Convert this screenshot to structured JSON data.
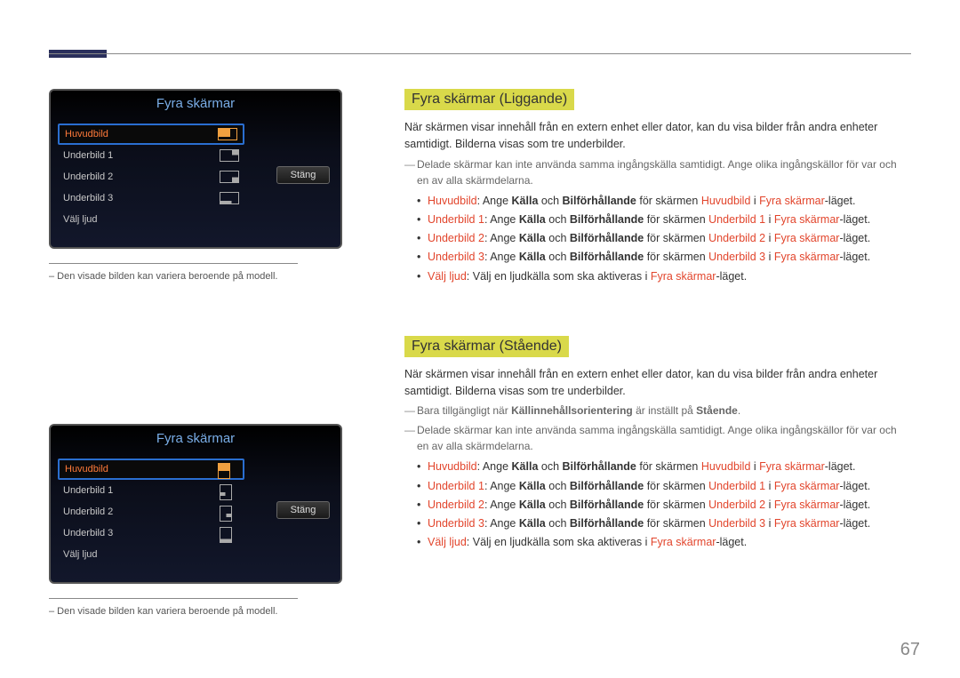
{
  "page_number": "67",
  "osd": {
    "title": "Fyra skärmar",
    "close": "Stäng",
    "items": [
      {
        "label": "Huvudbild",
        "selected": true
      },
      {
        "label": "Underbild 1",
        "selected": false
      },
      {
        "label": "Underbild 2",
        "selected": false
      },
      {
        "label": "Underbild 3",
        "selected": false
      },
      {
        "label": "Välj ljud",
        "selected": false
      }
    ],
    "caption": "– Den visade bilden kan variera beroende på modell."
  },
  "s1": {
    "heading": "Fyra skärmar (Liggande)",
    "p1": "När skärmen visar innehåll från en extern enhet eller dator, kan du visa bilder från andra enheter samtidigt. Bilderna visas som tre underbilder.",
    "note1": "Delade skärmar kan inte använda samma ingångskälla samtidigt. Ange olika ingångskällor för var och en av alla skärmdelarna.",
    "li": {
      "a": {
        "t0": "Huvudbild",
        "t1": ": Ange ",
        "t2": "Källa",
        "t3": " och ",
        "t4": "Bilförhållande",
        "t5": " för skärmen ",
        "t6": "Huvudbild",
        "t7": " i ",
        "t8": "Fyra skärmar",
        "t9": "-läget."
      },
      "b": {
        "t0": "Underbild 1",
        "t6": "Underbild 1"
      },
      "c": {
        "t0": "Underbild 2",
        "t6": "Underbild 2"
      },
      "d": {
        "t0": "Underbild 3",
        "t6": "Underbild 3"
      },
      "e": {
        "t0": "Välj ljud",
        "t1": ": Välj en ljudkälla som ska aktiveras i ",
        "t2": "Fyra skärmar",
        "t3": "-läget."
      }
    }
  },
  "s2": {
    "heading": "Fyra skärmar (Stående)",
    "p1": "När skärmen visar innehåll från en extern enhet eller dator, kan du visa bilder från andra enheter samtidigt. Bilderna visas som tre underbilder.",
    "note1a": "Bara tillgängligt när ",
    "note1b": "Källinnehållsorientering",
    "note1c": " är inställt på ",
    "note1d": "Stående",
    "note1e": ".",
    "note2": "Delade skärmar kan inte använda samma ingångskälla samtidigt. Ange olika ingångskällor för var och en av alla skärmdelarna."
  }
}
